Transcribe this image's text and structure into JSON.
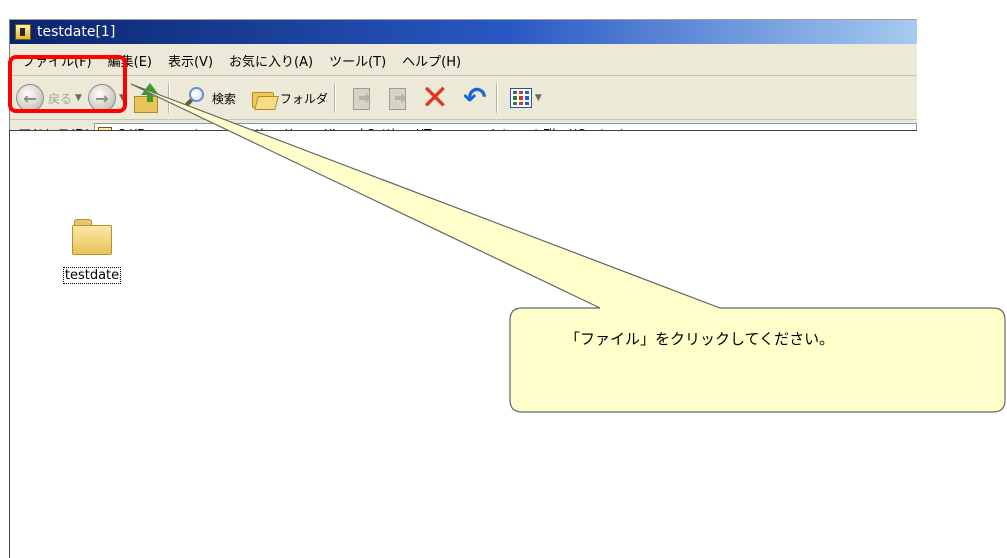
{
  "window": {
    "title": "testdate[1]"
  },
  "menu": {
    "items": [
      "ファイル(F)",
      "編集(E)",
      "表示(V)",
      "お気に入り(A)",
      "ツール(T)",
      "ヘルプ(H)"
    ]
  },
  "toolbar": {
    "back_label": "戻る",
    "search_label": "検索",
    "folders_label": "フォルダ"
  },
  "address": {
    "label": "アドレス(D)",
    "value": "C:¥Documents and Settings¥:　　 ¥Local Settings¥Temporary Internet Files¥Content"
  },
  "content": {
    "items": [
      {
        "label": "testdate"
      }
    ]
  },
  "callout": {
    "text": "「ファイル」をクリックしてください。",
    "fill": "#ffffcc",
    "stroke": "#666666"
  },
  "highlight": {
    "color": "#ff0000"
  }
}
